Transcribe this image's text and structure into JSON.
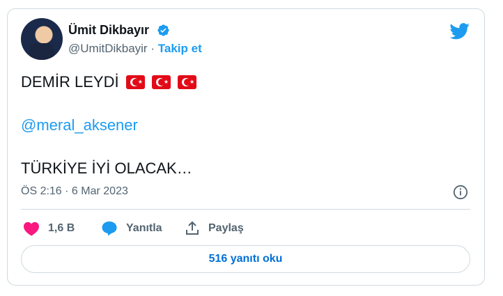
{
  "author": {
    "name": "Ümit Dikbayır",
    "handle": "@UmitDikbayir",
    "separator": "·",
    "follow_label": "Takip et"
  },
  "tweet": {
    "line1": "DEMİR LEYDİ",
    "flags": [
      "turkey-flag",
      "turkey-flag",
      "turkey-flag"
    ],
    "mention": "@meral_aksener",
    "line3": "TÜRKİYE İYİ OLACAK…",
    "timestamp": "ÖS 2:16 · 6 Mar 2023"
  },
  "actions": {
    "like_count": "1,6 B",
    "reply_label": "Yanıtla",
    "share_label": "Paylaş"
  },
  "replies_button": "516 yanıtı oku",
  "icons": [
    "avatar",
    "verified-badge-icon",
    "twitter-bird-icon",
    "info-icon",
    "heart-icon",
    "reply-bubble-icon",
    "share-icon"
  ],
  "colors": {
    "accent": "#1d9bf0",
    "heart": "#f91880",
    "secondary_text": "#536471",
    "border": "#cfd9de"
  }
}
